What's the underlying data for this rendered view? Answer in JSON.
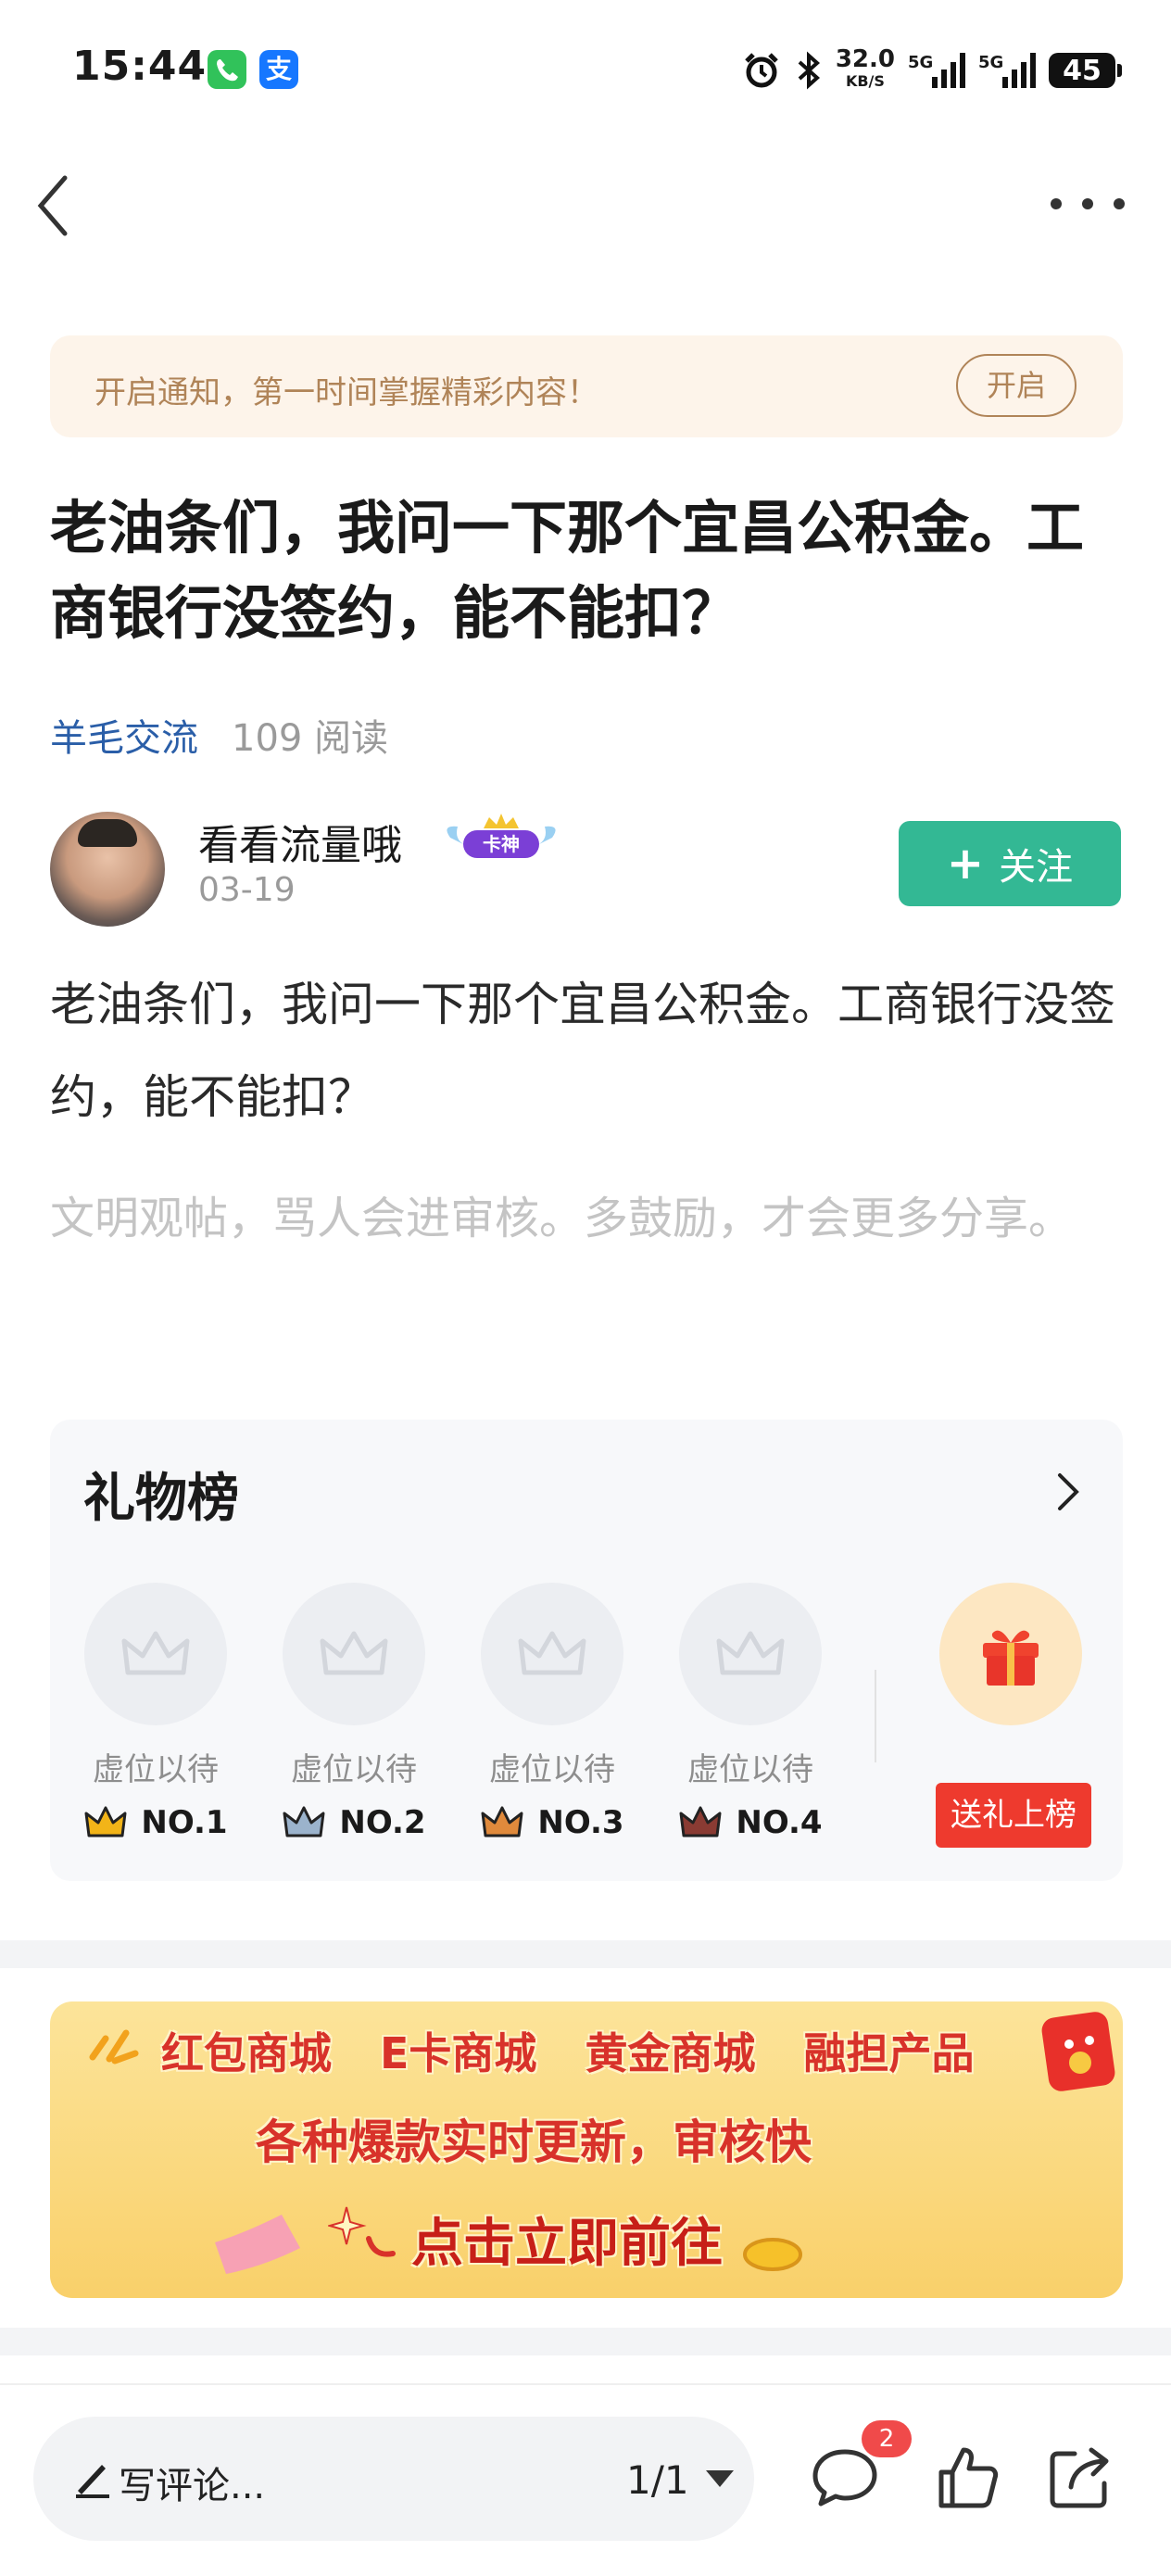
{
  "status_bar": {
    "time": "15:44",
    "apps": [
      "phone-icon",
      "alipay-icon"
    ],
    "alipay_glyph": "支",
    "speed_value": "32.0",
    "speed_unit": "KB/S",
    "network_1": "5G",
    "network_2": "5G",
    "battery": "45"
  },
  "notice": {
    "text": "开启通知，第一时间掌握精彩内容！",
    "button": "开启"
  },
  "post": {
    "title": "老油条们，我问一下那个宜昌公积金。工商银行没签约，能不能扣？",
    "category": "羊毛交流",
    "reads": "109 阅读",
    "body": "老油条们，我问一下那个宜昌公积金。工商银行没签约，能不能扣？",
    "hint": "文明观帖，骂人会进审核。多鼓励，才会更多分享。"
  },
  "author": {
    "name": "看看流量哦",
    "badge": "卡神",
    "date": "03-19",
    "follow_label": "关注",
    "follow_icon": "+"
  },
  "gift_board": {
    "title": "礼物榜",
    "slots": [
      {
        "label": "虚位以待",
        "rank": "NO.1",
        "crown_color": "#f2b418"
      },
      {
        "label": "虚位以待",
        "rank": "NO.2",
        "crown_color": "#9bb3cc"
      },
      {
        "label": "虚位以待",
        "rank": "NO.3",
        "crown_color": "#e08a3c"
      },
      {
        "label": "虚位以待",
        "rank": "NO.4",
        "crown_color": "#8a3b33"
      }
    ],
    "send_button": "送礼上榜"
  },
  "promo": {
    "categories": [
      "红包商城",
      "E卡商城",
      "黄金商城",
      "融担产品"
    ],
    "subtitle": "各种爆款实时更新，审核快",
    "cta": "点击立即前往"
  },
  "bottom_bar": {
    "comment_placeholder": "写评论...",
    "page_indicator": "1/1",
    "comment_count": "2"
  },
  "colors": {
    "accent_green": "#33b894",
    "link_blue": "#2a5ea8",
    "notice_brown": "#b08458",
    "gift_red": "#ee3a2e",
    "badge_red": "#f04a4a"
  }
}
